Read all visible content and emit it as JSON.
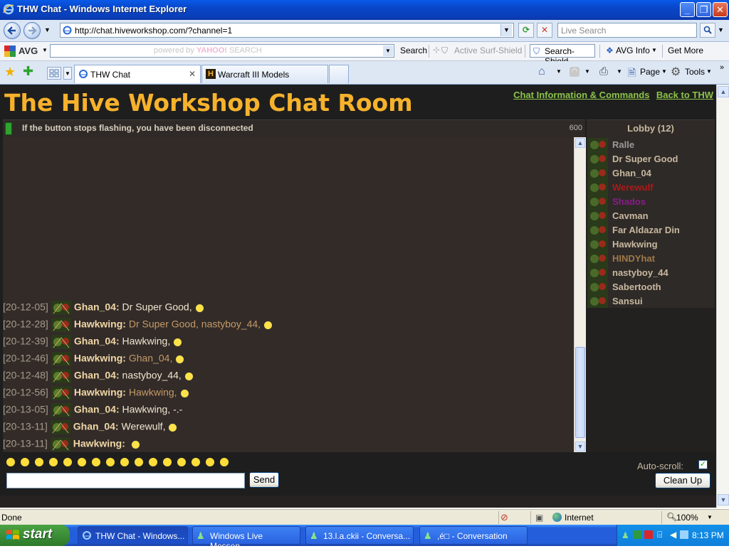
{
  "window": {
    "title": "THW Chat - Windows Internet Explorer",
    "minimize": "_",
    "maximize": "❐",
    "close": "✕"
  },
  "address_bar": {
    "url": "http://chat.hiveworkshop.com/?channel=1",
    "live_search_placeholder": "Live Search"
  },
  "avg_toolbar": {
    "brand": "AVG",
    "search_placeholder_prefix": "powered by",
    "search_placeholder_brand": "YAHOO!",
    "search_placeholder_suffix": "SEARCH",
    "search_button": "Search",
    "active_surf_shield": "Active  Surf-Shield",
    "search_shield": "Search-Shield",
    "avg_info": "AVG Info",
    "get_more": "Get More"
  },
  "tabs": [
    {
      "label": "THW Chat",
      "active": true
    },
    {
      "label": "Warcraft III Models",
      "active": false
    }
  ],
  "command_bar": {
    "page": "Page",
    "tools": "Tools"
  },
  "chat": {
    "title": "The Hive Workshop Chat Room",
    "links": [
      {
        "label": "Chat Information & Commands"
      },
      {
        "label": "Back to THW"
      }
    ],
    "status_message": "If the button stops flashing, you have been disconnected",
    "status_counter": "600",
    "messages": [
      {
        "time": "[20-12-05]",
        "user": "Ghan_04:",
        "text": "Dr Super Good,",
        "emote": true,
        "style": "normal"
      },
      {
        "time": "[20-12-28]",
        "user": "Hawkwing:",
        "text": "Dr Super Good, nastyboy_44,",
        "emote": true,
        "style": "orange"
      },
      {
        "time": "[20-12-39]",
        "user": "Ghan_04:",
        "text": "Hawkwing,",
        "emote": true,
        "style": "normal"
      },
      {
        "time": "[20-12-46]",
        "user": "Hawkwing:",
        "text": "Ghan_04,",
        "emote": true,
        "style": "orange"
      },
      {
        "time": "[20-12-48]",
        "user": "Ghan_04:",
        "text": "nastyboy_44,",
        "emote": true,
        "style": "normal"
      },
      {
        "time": "[20-12-56]",
        "user": "Hawkwing:",
        "text": "Hawkwing,",
        "emote": true,
        "style": "orange"
      },
      {
        "time": "[20-13-05]",
        "user": "Ghan_04:",
        "text": "Hawkwing, -.-",
        "emote": false,
        "style": "normal"
      },
      {
        "time": "[20-13-11]",
        "user": "Ghan_04:",
        "text": "Werewulf,",
        "emote": true,
        "style": "normal"
      },
      {
        "time": "[20-13-11]",
        "user": "Hawkwing:",
        "text": "",
        "emote": true,
        "style": "orange"
      }
    ],
    "lobby_title": "Lobby (12)",
    "lobby_users": [
      {
        "name": "Ralle",
        "color": "#9a9a9a"
      },
      {
        "name": "Dr Super Good",
        "color": "#c8b8a0"
      },
      {
        "name": "Ghan_04",
        "color": "#c8b8a0"
      },
      {
        "name": "Werewulf",
        "color": "#b01818"
      },
      {
        "name": "Shados",
        "color": "#8a1c8a"
      },
      {
        "name": "Cavman",
        "color": "#c8b8a0"
      },
      {
        "name": "Far Aldazar Din",
        "color": "#c8b8a0"
      },
      {
        "name": "Hawkwing",
        "color": "#c8b8a0"
      },
      {
        "name": "HINDYhat",
        "color": "#9e7a4a"
      },
      {
        "name": "nastyboy_44",
        "color": "#c8b8a0"
      },
      {
        "name": "Sabertooth",
        "color": "#c8b8a0"
      },
      {
        "name": "Sansui",
        "color": "#c8b8a0"
      }
    ],
    "emote_count": 16,
    "auto_scroll_label": "Auto-scroll:",
    "auto_scroll_checked": true,
    "send_button": "Send",
    "clean_up_button": "Clean Up",
    "message_input_value": ""
  },
  "status_bar": {
    "left": "Done",
    "zone": "Internet",
    "zoom": "100%"
  },
  "taskbar": {
    "start": "start",
    "items": [
      {
        "label": "THW Chat - Windows...",
        "active": true
      },
      {
        "label": "Windows Live Messen...",
        "active": false
      },
      {
        "label": "13.l.a.ckii - Conversa...",
        "active": false
      },
      {
        "label": ",é□ - Conversation",
        "active": false
      }
    ],
    "clock": "8:13 PM"
  },
  "colors": {
    "title_orange": "#f7b22c",
    "link_green": "#8bc34a",
    "chat_bg": "#322b28",
    "xp_blue": "#245edb"
  }
}
